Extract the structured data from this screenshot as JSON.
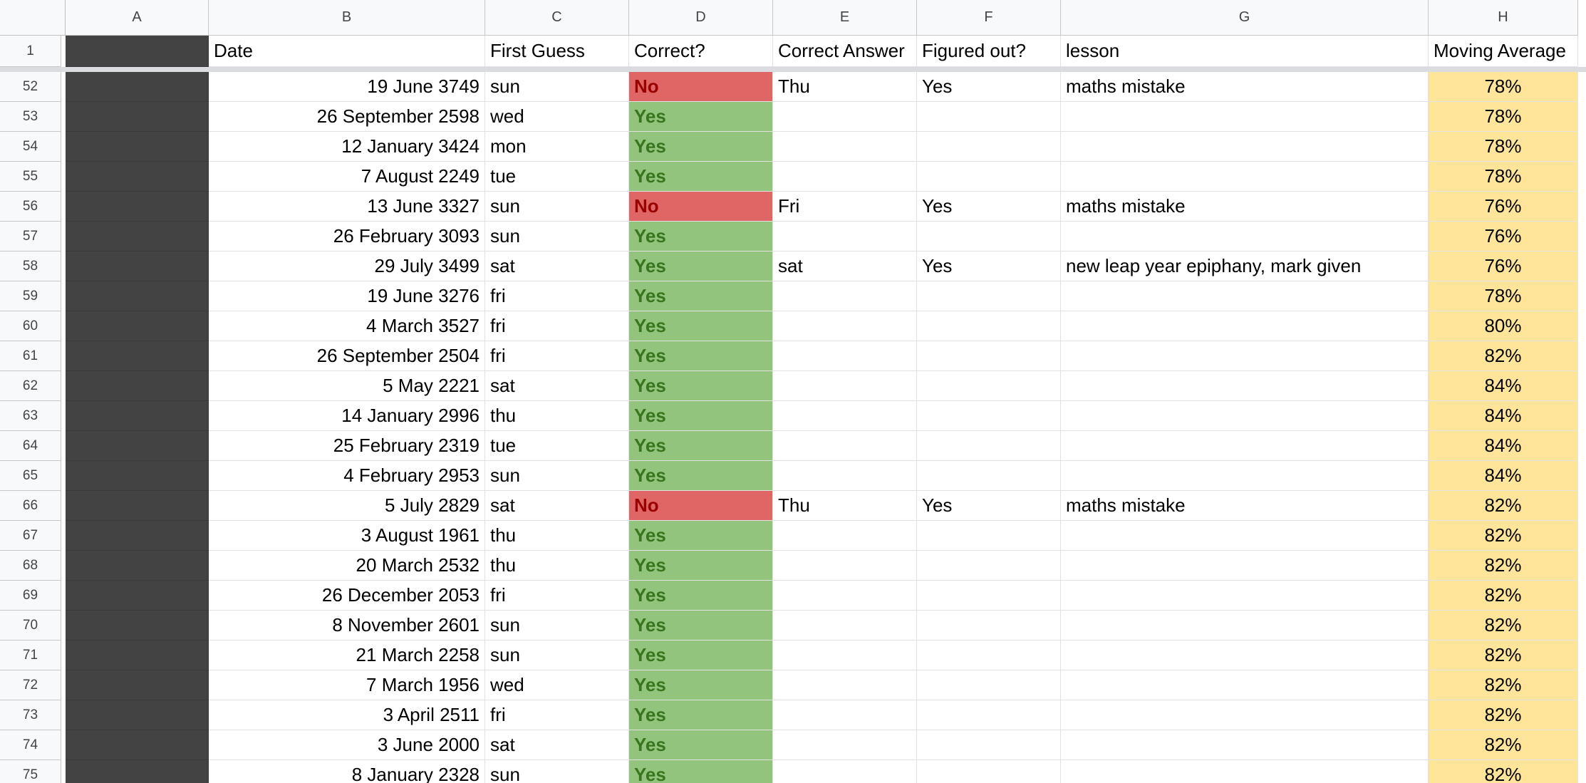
{
  "columns": [
    "A",
    "B",
    "C",
    "D",
    "E",
    "F",
    "G",
    "H"
  ],
  "header_row": {
    "number": "1",
    "cells": [
      "",
      "Date",
      "First Guess",
      "Correct?",
      "Correct Answer",
      "Figured out?",
      "lesson",
      "Moving Average"
    ]
  },
  "rows": [
    {
      "n": "52",
      "date": "19 June 3749",
      "guess": "sun",
      "correct": "No",
      "answer": "Thu",
      "figured": "Yes",
      "lesson": "maths mistake",
      "avg": "78%"
    },
    {
      "n": "53",
      "date": "26 September 2598",
      "guess": "wed",
      "correct": "Yes",
      "answer": "",
      "figured": "",
      "lesson": "",
      "avg": "78%"
    },
    {
      "n": "54",
      "date": "12 January 3424",
      "guess": "mon",
      "correct": "Yes",
      "answer": "",
      "figured": "",
      "lesson": "",
      "avg": "78%"
    },
    {
      "n": "55",
      "date": "7 August 2249",
      "guess": "tue",
      "correct": "Yes",
      "answer": "",
      "figured": "",
      "lesson": "",
      "avg": "78%"
    },
    {
      "n": "56",
      "date": "13 June 3327",
      "guess": "sun",
      "correct": "No",
      "answer": "Fri",
      "figured": "Yes",
      "lesson": "maths mistake",
      "avg": "76%"
    },
    {
      "n": "57",
      "date": "26 February 3093",
      "guess": "sun",
      "correct": "Yes",
      "answer": "",
      "figured": "",
      "lesson": "",
      "avg": "76%"
    },
    {
      "n": "58",
      "date": "29 July 3499",
      "guess": "sat",
      "correct": "Yes",
      "answer": "sat",
      "figured": "Yes",
      "lesson": "new leap year epiphany, mark given",
      "avg": "76%"
    },
    {
      "n": "59",
      "date": "19 June 3276",
      "guess": "fri",
      "correct": "Yes",
      "answer": "",
      "figured": "",
      "lesson": "",
      "avg": "78%"
    },
    {
      "n": "60",
      "date": "4 March 3527",
      "guess": "fri",
      "correct": "Yes",
      "answer": "",
      "figured": "",
      "lesson": "",
      "avg": "80%"
    },
    {
      "n": "61",
      "date": "26 September 2504",
      "guess": "fri",
      "correct": "Yes",
      "answer": "",
      "figured": "",
      "lesson": "",
      "avg": "82%"
    },
    {
      "n": "62",
      "date": "5 May 2221",
      "guess": "sat",
      "correct": "Yes",
      "answer": "",
      "figured": "",
      "lesson": "",
      "avg": "84%"
    },
    {
      "n": "63",
      "date": "14 January 2996",
      "guess": "thu",
      "correct": "Yes",
      "answer": "",
      "figured": "",
      "lesson": "",
      "avg": "84%"
    },
    {
      "n": "64",
      "date": "25 February 2319",
      "guess": "tue",
      "correct": "Yes",
      "answer": "",
      "figured": "",
      "lesson": "",
      "avg": "84%"
    },
    {
      "n": "65",
      "date": "4 February 2953",
      "guess": "sun",
      "correct": "Yes",
      "answer": "",
      "figured": "",
      "lesson": "",
      "avg": "84%"
    },
    {
      "n": "66",
      "date": "5 July 2829",
      "guess": "sat",
      "correct": "No",
      "answer": "Thu",
      "figured": "Yes",
      "lesson": "maths mistake",
      "avg": "82%"
    },
    {
      "n": "67",
      "date": "3 August 1961",
      "guess": "thu",
      "correct": "Yes",
      "answer": "",
      "figured": "",
      "lesson": "",
      "avg": "82%"
    },
    {
      "n": "68",
      "date": "20 March 2532",
      "guess": "thu",
      "correct": "Yes",
      "answer": "",
      "figured": "",
      "lesson": "",
      "avg": "82%"
    },
    {
      "n": "69",
      "date": "26 December 2053",
      "guess": "fri",
      "correct": "Yes",
      "answer": "",
      "figured": "",
      "lesson": "",
      "avg": "82%"
    },
    {
      "n": "70",
      "date": "8 November 2601",
      "guess": "sun",
      "correct": "Yes",
      "answer": "",
      "figured": "",
      "lesson": "",
      "avg": "82%"
    },
    {
      "n": "71",
      "date": "21 March 2258",
      "guess": "sun",
      "correct": "Yes",
      "answer": "",
      "figured": "",
      "lesson": "",
      "avg": "82%"
    },
    {
      "n": "72",
      "date": "7 March 1956",
      "guess": "wed",
      "correct": "Yes",
      "answer": "",
      "figured": "",
      "lesson": "",
      "avg": "82%"
    },
    {
      "n": "73",
      "date": "3 April 2511",
      "guess": "fri",
      "correct": "Yes",
      "answer": "",
      "figured": "",
      "lesson": "",
      "avg": "82%"
    },
    {
      "n": "74",
      "date": "3 June 2000",
      "guess": "sat",
      "correct": "Yes",
      "answer": "",
      "figured": "",
      "lesson": "",
      "avg": "82%"
    },
    {
      "n": "75",
      "date": "8 January 2328",
      "guess": "sun",
      "correct": "Yes",
      "answer": "",
      "figured": "",
      "lesson": "",
      "avg": "82%"
    }
  ],
  "colors": {
    "yes_fill": "#93c47d",
    "yes_text": "#38761d",
    "no_fill": "#e06666",
    "no_text": "#990000",
    "average_fill": "#ffe599",
    "column_a_fill": "#434343"
  }
}
